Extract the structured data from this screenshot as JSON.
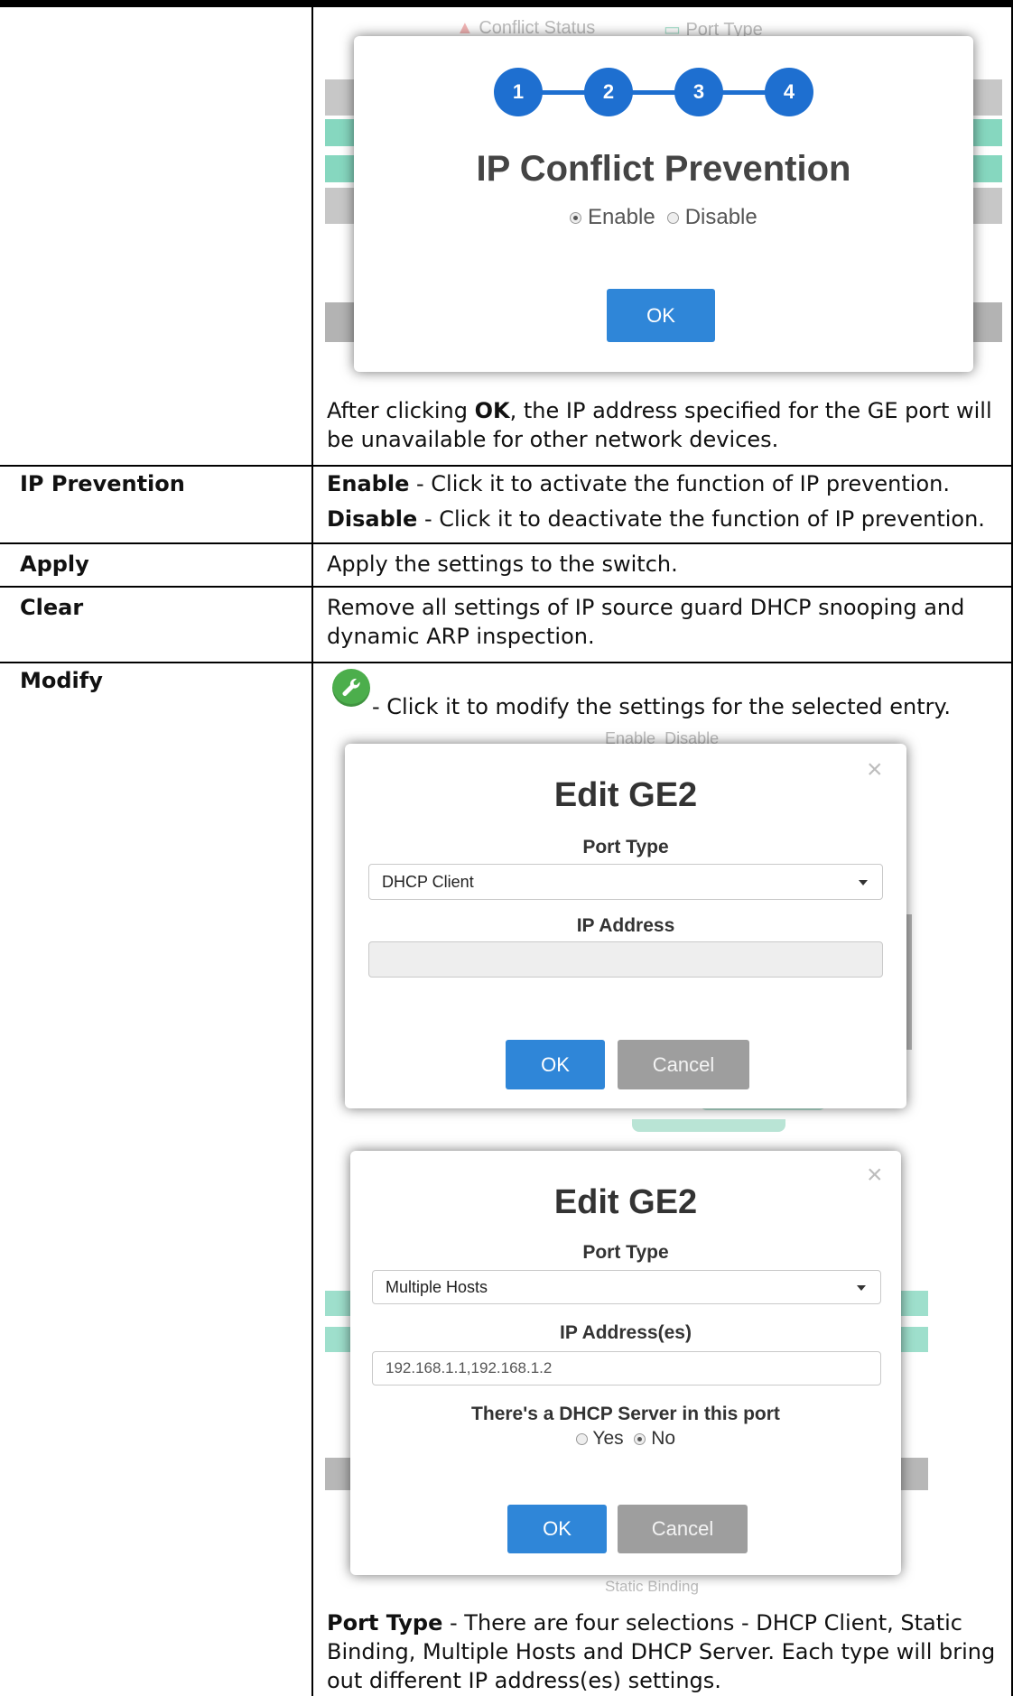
{
  "wizard": {
    "steps": [
      "1",
      "2",
      "3",
      "4"
    ],
    "title": "IP Conflict Prevention",
    "enable_label": "Enable",
    "disable_label": "Disable",
    "ok_label": "OK",
    "bg_conflict_status": "Conflict Status",
    "bg_port_type": "Port Type"
  },
  "after_ok": {
    "prefix": "After clicking ",
    "bold": "OK",
    "line1_rest": ", the IP address specified for the GE port will",
    "line2": "be unavailable for other network devices."
  },
  "rows": {
    "ip_prevention": {
      "term": "IP Prevention",
      "enable_term": "Enable",
      "enable_desc": " - Click it to activate the function of IP prevention.",
      "disable_term": "Disable",
      "disable_desc": " - Click it to deactivate the function of IP prevention."
    },
    "apply": {
      "term": "Apply",
      "desc": "Apply the settings to the switch."
    },
    "clear": {
      "term": "Clear",
      "desc_line1": "Remove all settings of IP source guard DHCP snooping and",
      "desc_line2": "dynamic ARP inspection."
    },
    "modify": {
      "term": "Modify",
      "desc": "- Click it to modify the settings for the selected entry."
    },
    "port_type": {
      "term": "Port Type",
      "line1_rest": " - There are four selections - DHCP Client, Static",
      "line2": "Binding, Multiple Hosts and DHCP Server. Each type will bring",
      "line3": "out different IP address(es) settings."
    }
  },
  "edit_dialog_1": {
    "title": "Edit GE2",
    "port_type_label": "Port Type",
    "port_type_value": "DHCP Client",
    "ip_label": "IP Address",
    "ip_value": "",
    "ok_label": "OK",
    "cancel_label": "Cancel",
    "bg_enable": "Enable",
    "bg_disable": "Disable"
  },
  "edit_dialog_2": {
    "title": "Edit GE2",
    "port_type_label": "Port Type",
    "port_type_value": "Multiple Hosts",
    "ip_label": "IP Address(es)",
    "ip_value": "192.168.1.1,192.168.1.2",
    "dhcp_question": "There's a DHCP Server in this port",
    "yes_label": "Yes",
    "no_label": "No",
    "ok_label": "OK",
    "cancel_label": "Cancel",
    "bg_static_binding": "Static Binding"
  },
  "icons": [
    "wrench-icon",
    "close-icon",
    "chevron-down-icon"
  ],
  "colors": {
    "accent": "#2f86d8",
    "step_blue": "#1e6fd0",
    "cancel_grey": "#9e9e9e",
    "wrench_green": "#4cae4c"
  }
}
